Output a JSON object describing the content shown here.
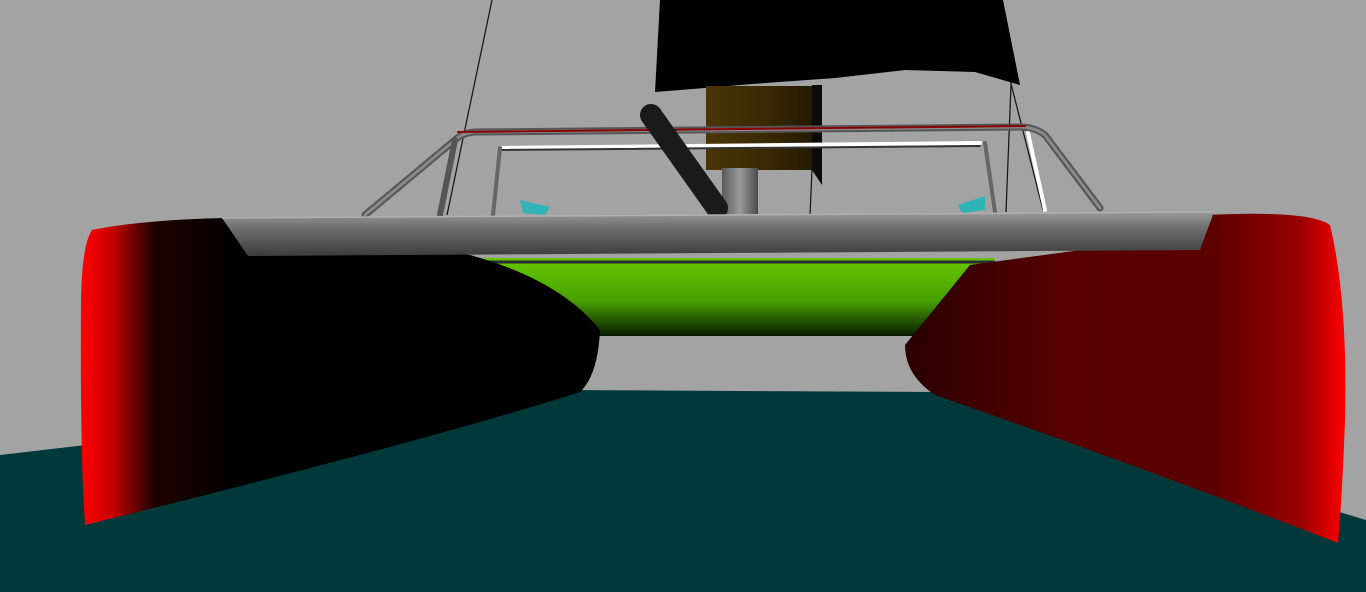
{
  "scene": {
    "subject": "catamaran-3d-render",
    "colors": {
      "sky": "#a3a3a3",
      "water": "#01393b",
      "hull_red": "#ff0000",
      "hull_dark": "#000000",
      "hull_dark_red": "#5a0000",
      "trampoline_green": "#5fbe00",
      "beam_gray": "#666666",
      "sail": "#000000",
      "mast_sleeve": "#3e2d05",
      "rudder_cyan": "#2fb3b7",
      "rail_white": "#ffffff"
    },
    "icons": [
      "sail-icon",
      "mast-icon",
      "hull-icon",
      "rudder-icon",
      "tiller-icon"
    ]
  }
}
